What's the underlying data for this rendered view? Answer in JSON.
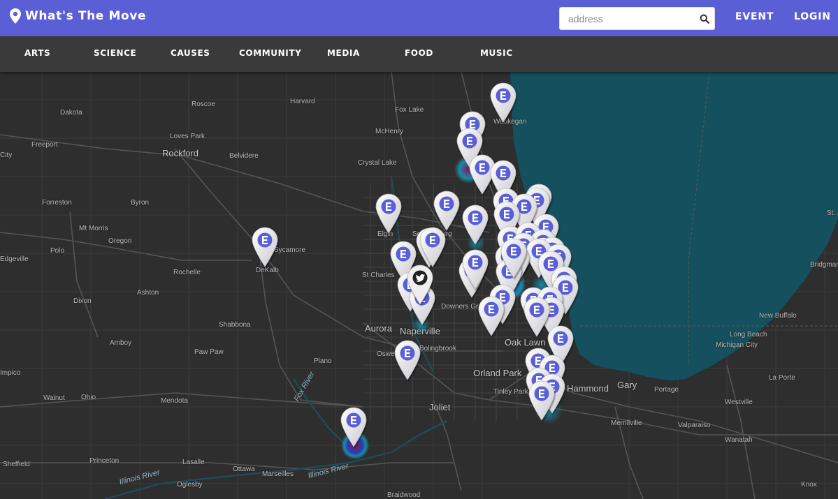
{
  "header": {
    "brand_title": "What's The Move",
    "brand_icon": "map-pin-icon",
    "search": {
      "placeholder": "address",
      "value": "",
      "icon": "search-icon"
    },
    "links": {
      "event": "EVENT",
      "login": "LOGIN"
    },
    "color": "#5b5fd6"
  },
  "categories": [
    "ARTS",
    "SCIENCE",
    "CAUSES",
    "COMMUNITY",
    "MEDIA",
    "FOOD",
    "MUSIC"
  ],
  "map": {
    "theme": "dark",
    "lake_color": "#15505e",
    "water_label": "",
    "cities": [
      "Harvard",
      "Dakota",
      "Roscoe",
      "Fox Lake",
      "Waukegan",
      "Freeport",
      "Loves Park",
      "McHenry",
      "Rockford",
      "Belvidere",
      "Crystal Lake",
      "Forreston",
      "Byron",
      "Elgin",
      "Schaumburg",
      "Mt Morris",
      "Oregon",
      "Sycamore",
      "Polo",
      "DeKalb",
      "St Charles",
      "Rochelle",
      "Edgeville",
      "Ashton",
      "Dixon",
      "Downers Grove",
      "Aurora",
      "Naperville",
      "Bolingbrook",
      "Shabbona",
      "Amboy",
      "Paw Paw",
      "Oswego",
      "Plano",
      "Oak Lawn",
      "Orland Park",
      "Tinley Park",
      "Gary",
      "Hammond",
      "Joliet",
      "Mendota",
      "Walnut",
      "Ohio",
      "Lasalle",
      "Ottawa",
      "Marseilles",
      "Princeton",
      "Sheffield",
      "Oglesby",
      "Braidwood",
      "Merrillville",
      "Valparaiso",
      "Portage",
      "Westville",
      "Wanatah",
      "La Porte",
      "Michigan City",
      "Long Beach",
      "New Buffalo",
      "Bridgman",
      "St. J",
      "Knox",
      "Impico",
      "City"
    ],
    "rivers": [
      "Illinois River",
      "Illinois River",
      "Fox River"
    ],
    "marker_icon": "event-e-icon",
    "marker_color": "#5b5fd6",
    "twitter_marker_icon": "twitter-icon"
  }
}
